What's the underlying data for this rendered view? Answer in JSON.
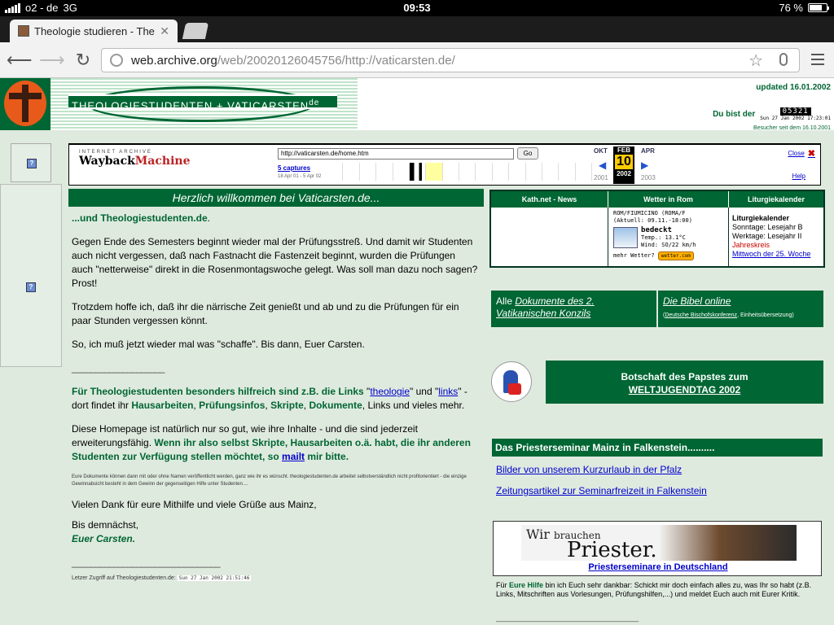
{
  "status": {
    "carrier": "o2 - de",
    "network": "3G",
    "time": "09:53",
    "battery": "76 %",
    "battery_level": 0.76
  },
  "browser": {
    "tab_title": "Theologie studieren - Theol",
    "url_host": "web.archive.org",
    "url_path": "/web/20020126045756/http://vaticarsten.de/"
  },
  "header": {
    "banner_text": "THEOLOGIESTUDENTEN + VATICARSTEN",
    "banner_sup": "de",
    "updated": "updated 16.01.2002",
    "visitor_label": "Du bist der",
    "counter_digits": "05321",
    "counter_date": "Sun 27 Jan 2002 17:23:01",
    "visitors_since": "Besucher seit dem 16.10.2001"
  },
  "wayback": {
    "ia_label": "INTERNET ARCHIVE",
    "logo_a": "Wayback",
    "logo_b": "Machine",
    "url": "http://vaticarsten.de/home.htm",
    "go": "Go",
    "captures": "5 captures",
    "range": "18 Apr 01 - 5 Apr 02",
    "prev_month": "OKT",
    "cur_month": "FEB",
    "next_month": "APR",
    "cur_day": "10",
    "cur_year": "2002",
    "prev_year": "2001",
    "next_year": "2003",
    "close": "Close",
    "help": "Help"
  },
  "main": {
    "heading": "Herzlich willkommen bei Vaticarsten.de...",
    "sub": "...und Theologiestudenten.de",
    "sub_dot": ".",
    "p1": "Gegen Ende des Semesters beginnt wieder mal der Prüfungsstreß. Und damit wir Studenten auch nicht vergessen, daß nach Fastnacht die Fastenzeit beginnt, wurden die Prüfungen auch \"netterweise\" direkt in die Rosenmontagswoche gelegt. Was soll man dazu noch sagen? Prost!",
    "p2": "Trotzdem hoffe ich, daß ihr die närrische Zeit genießt und ab und zu die Prüfungen für ein paar Stunden vergessen könnt.",
    "p3": "So, ich muß jetzt wieder mal was \"schaffe\". Bis dann, Euer Carsten.",
    "divider": "____________________",
    "p4_a": "Für Theologiestudenten besonders hilfreich sind z.B. die Links ",
    "p4_link1": "theologie",
    "p4_and": "\" und \"",
    "p4_link2": "links",
    "p4_b": "\" - dort findet ihr ",
    "p4_c": "Hausarbeiten",
    "p4_d": "Prüfungsinfos",
    "p4_e": "Skripte",
    "p4_f": "Dokumente",
    "p4_g": ", Links und vieles mehr.",
    "p5_a": "Diese Homepage ist natürlich nur so gut, wie ihre Inhalte - und die sind jederzeit erweiterungsfähig. ",
    "p5_b": "Wenn ihr also selbst Skripte, Hausarbeiten o.ä. habt, die ihr anderen Studenten zur Verfügung stellen möchtet, so ",
    "p5_link": "mailt",
    "p5_c": " mir bitte.",
    "small": "Eure Dokumente können dann mit oder ohne Namen veröffentlicht werden, ganz wie ihr es wünscht. theologiestudenten.de arbeitet selbstverständlich nicht profitorientiert - die einzige Gewinnabsicht besteht in dem Gewinn der gegenseitigen Hilfe unter Studenten....",
    "thanks": "Vielen Dank für eure Mithilfe und viele Grüße aus Mainz,",
    "bye": "Bis demnächst,",
    "signature": "Euer Carsten.",
    "divider2": "________________________________",
    "last_access": "Letzer Zugriff auf Theologiestudenten.de:",
    "last_access_date": "Sun 27 Jan 2002 21:51:46"
  },
  "right": {
    "col1": "Kath.net - News",
    "col2": "Wetter in Rom",
    "col3": "Liturgiekalender",
    "weather_loc": "ROM/FIUMICINO (ROMA/F",
    "weather_upd": "(Aktuell: 09.11.-18:00)",
    "weather_cond": "bedeckt",
    "weather_temp": "Temp.: 13.1°C",
    "weather_wind": "Wind: SO/22 km/h",
    "weather_more": "mehr Wetter?",
    "weather_btn": "wetter.com",
    "lit_title": "Liturgiekalender",
    "lit_sun": "Sonntage: Lesejahr B",
    "lit_week": "Werktage: Lesejahr II",
    "lit_red": "Jahreskreis",
    "lit_link": "Mittwoch der 25. Woche",
    "box1_a": "Alle ",
    "box1_b": "Dokumente des 2. Vatikanischen Konzils",
    "box2_a": "Die Bibel online",
    "box2_b": "Deutsche Bischofskonferenz",
    "box2_c": ", Einheitsübersetzung)",
    "box2_open": "(",
    "box3_a": "Botschaft des Papstes zum",
    "box3_b": "WELTJUGENDTAG 2002",
    "box4": "Das Priesterseminar Mainz in Falkenstein..........",
    "link1": "Bilder von unserem Kurzurlaub in der Pfalz",
    "link2": "Zeitungsartikel zur Seminarfreizeit in Falkenstein",
    "pr_w1": "Wir",
    "pr_w1b": "brauchen",
    "pr_w2": "Priester.",
    "pr_link": "Priesterseminare in Deutschland",
    "help_a": "Für ",
    "help_b": "Eure Hilfe",
    "help_c": " bin ich Euch sehr dankbar: Schickt mir doch einfach alles zu, was Ihr so habt (z.B. Links, Mitschriften aus Vorlesungen, Prüfungshilfen,...) und meldet Euch auch mit Eurer Kritik.",
    "help_div": "___________________________________"
  },
  "colors": {
    "site_green": "#006633",
    "link_blue": "#0000cc",
    "page_bg": "#dfeadf"
  }
}
